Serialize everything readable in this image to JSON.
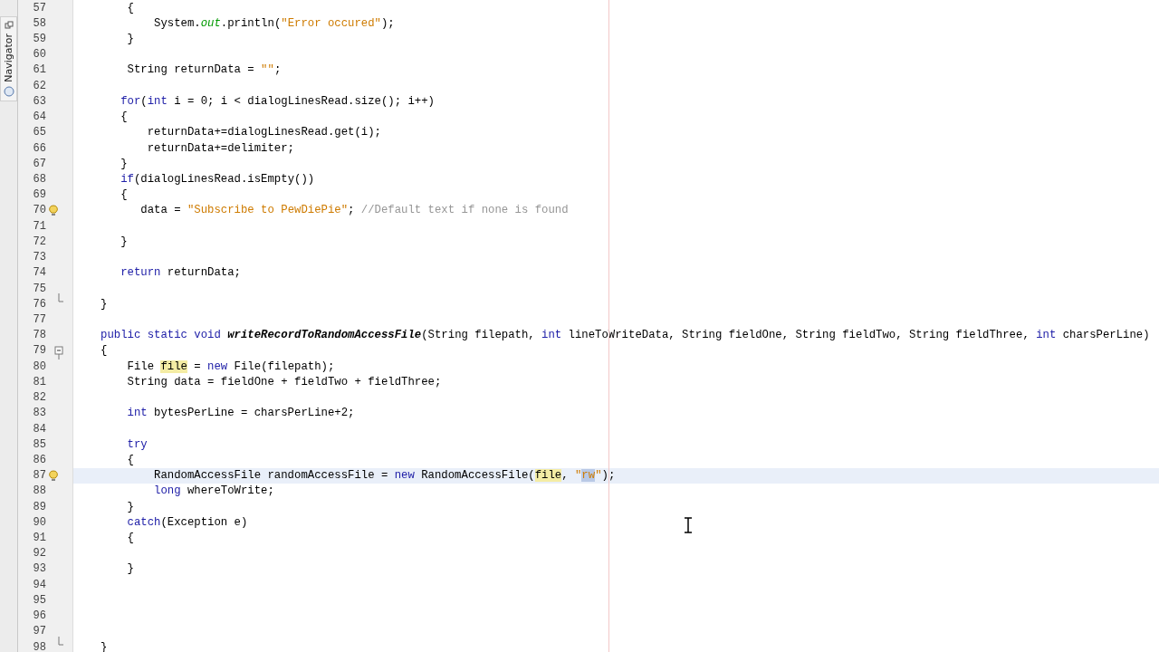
{
  "side_tabs": [
    {
      "label": "Navigator"
    }
  ],
  "editor": {
    "lines": [
      {
        "number": "57",
        "tokens": [
          {
            "kind": "plain",
            "text": "    {"
          }
        ]
      },
      {
        "number": "58",
        "tokens": [
          {
            "kind": "plain",
            "text": "        System."
          },
          {
            "kind": "field",
            "text": "out"
          },
          {
            "kind": "plain",
            "text": ".println("
          },
          {
            "kind": "string",
            "text": "\"Error occured\""
          },
          {
            "kind": "plain",
            "text": ");"
          }
        ]
      },
      {
        "number": "59",
        "tokens": [
          {
            "kind": "plain",
            "text": "    }"
          }
        ]
      },
      {
        "number": "60"
      },
      {
        "number": "61",
        "tokens": [
          {
            "kind": "plain",
            "text": "    String returnData = "
          },
          {
            "kind": "string",
            "text": "\"\""
          },
          {
            "kind": "plain",
            "text": ";"
          }
        ]
      },
      {
        "number": "62"
      },
      {
        "number": "63",
        "tokens": [
          {
            "kind": "keyword",
            "text": "   for"
          },
          {
            "kind": "plain",
            "text": "("
          },
          {
            "kind": "keyword",
            "text": "int"
          },
          {
            "kind": "plain",
            "text": " i = 0; i < dialogLinesRead.size(); i++)"
          }
        ]
      },
      {
        "number": "64",
        "tokens": [
          {
            "kind": "plain",
            "text": "   {"
          }
        ]
      },
      {
        "number": "65",
        "tokens": [
          {
            "kind": "plain",
            "text": "       returnData+=dialogLinesRead.get(i);"
          }
        ]
      },
      {
        "number": "66",
        "tokens": [
          {
            "kind": "plain",
            "text": "       returnData+=delimiter;"
          }
        ]
      },
      {
        "number": "67",
        "tokens": [
          {
            "kind": "plain",
            "text": "   }"
          }
        ]
      },
      {
        "number": "68",
        "tokens": [
          {
            "kind": "keyword",
            "text": "   if"
          },
          {
            "kind": "plain",
            "text": "(dialogLinesRead.isEmpty())"
          }
        ]
      },
      {
        "number": "69",
        "tokens": [
          {
            "kind": "plain",
            "text": "   {"
          }
        ]
      },
      {
        "number": "70",
        "hint": true,
        "tokens": [
          {
            "kind": "plain",
            "text": "      data = "
          },
          {
            "kind": "string",
            "text": "\"Subscribe to PewDiePie\""
          },
          {
            "kind": "plain",
            "text": "; "
          },
          {
            "kind": "comment",
            "text": "//Default text if none is found"
          }
        ]
      },
      {
        "number": "71"
      },
      {
        "number": "72",
        "tokens": [
          {
            "kind": "plain",
            "text": "   }"
          }
        ]
      },
      {
        "number": "73"
      },
      {
        "number": "74",
        "tokens": [
          {
            "kind": "keyword",
            "text": "   return"
          },
          {
            "kind": "plain",
            "text": " returnData;"
          }
        ]
      },
      {
        "number": "75"
      },
      {
        "number": "76",
        "fold_end": true,
        "tokens": [
          {
            "kind": "plain",
            "text": "}"
          }
        ]
      },
      {
        "number": "77"
      },
      {
        "number": "78",
        "tokens": [
          {
            "kind": "keyword",
            "text": "public static void "
          },
          {
            "kind": "decl",
            "text": "writeRecordToRandomAccessFile"
          },
          {
            "kind": "plain",
            "text": "(String filepath, "
          },
          {
            "kind": "keyword",
            "text": "int"
          },
          {
            "kind": "plain",
            "text": " lineToWriteData, String fieldOne, String fieldTwo, String fieldThree, "
          },
          {
            "kind": "keyword",
            "text": "int"
          },
          {
            "kind": "plain",
            "text": " charsPerLine)"
          }
        ]
      },
      {
        "number": "79",
        "fold_start": true,
        "tokens": [
          {
            "kind": "plain",
            "text": "{"
          }
        ]
      },
      {
        "number": "80",
        "tokens": [
          {
            "kind": "plain",
            "text": "    File "
          },
          {
            "kind": "mark",
            "text": "file"
          },
          {
            "kind": "plain",
            "text": " = "
          },
          {
            "kind": "keyword",
            "text": "new"
          },
          {
            "kind": "plain",
            "text": " File(filepath);"
          }
        ]
      },
      {
        "number": "81",
        "tokens": [
          {
            "kind": "plain",
            "text": "    String data = fieldOne + fieldTwo + fieldThree;"
          }
        ]
      },
      {
        "number": "82"
      },
      {
        "number": "83",
        "tokens": [
          {
            "kind": "keyword",
            "text": "    int"
          },
          {
            "kind": "plain",
            "text": " bytesPerLine = charsPerLine+2;"
          }
        ]
      },
      {
        "number": "84"
      },
      {
        "number": "85",
        "tokens": [
          {
            "kind": "keyword",
            "text": "    try"
          }
        ]
      },
      {
        "number": "86",
        "tokens": [
          {
            "kind": "plain",
            "text": "    {"
          }
        ]
      },
      {
        "number": "87",
        "hint": true,
        "current": true,
        "tokens": [
          {
            "kind": "plain",
            "text": "        RandomAccessFile randomAccessFile = "
          },
          {
            "kind": "keyword",
            "text": "new"
          },
          {
            "kind": "plain",
            "text": " RandomAccessFile("
          },
          {
            "kind": "mark",
            "text": "file"
          },
          {
            "kind": "plain",
            "text": ", "
          },
          {
            "kind": "string",
            "text": "\""
          },
          {
            "kind": "selection",
            "text": "rw"
          },
          {
            "kind": "string",
            "text": "\""
          },
          {
            "kind": "plain",
            "text": ");"
          }
        ]
      },
      {
        "number": "88",
        "tokens": [
          {
            "kind": "keyword",
            "text": "        long"
          },
          {
            "kind": "plain",
            "text": " whereToWrite;"
          }
        ]
      },
      {
        "number": "89",
        "tokens": [
          {
            "kind": "plain",
            "text": "    }"
          }
        ]
      },
      {
        "number": "90",
        "tokens": [
          {
            "kind": "keyword",
            "text": "    catch"
          },
          {
            "kind": "plain",
            "text": "(Exception e)"
          }
        ]
      },
      {
        "number": "91",
        "tokens": [
          {
            "kind": "plain",
            "text": "    {"
          }
        ]
      },
      {
        "number": "92"
      },
      {
        "number": "93",
        "tokens": [
          {
            "kind": "plain",
            "text": "    }"
          }
        ]
      },
      {
        "number": "94"
      },
      {
        "number": "95"
      },
      {
        "number": "96"
      },
      {
        "number": "97"
      },
      {
        "number": "98",
        "fold_end": true,
        "tokens": [
          {
            "kind": "plain",
            "text": "}"
          }
        ]
      }
    ]
  }
}
